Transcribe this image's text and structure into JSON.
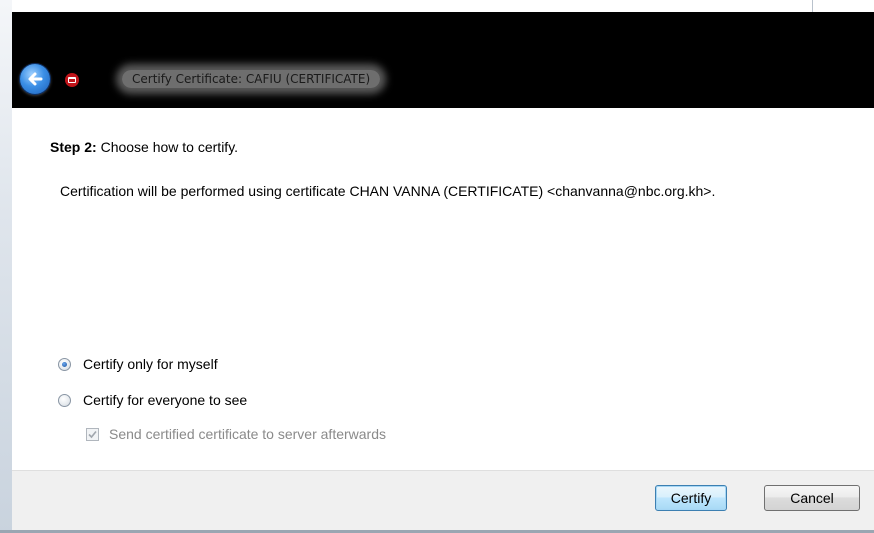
{
  "window": {
    "title": "Certify Certificate: CAFIU (CERTIFICATE)"
  },
  "content": {
    "step_label": "Step 2:",
    "step_text": " Choose how to certify.",
    "description": "Certification will be performed using certificate CHAN VANNA (CERTIFICATE) <chanvanna@nbc.org.kh>."
  },
  "options": {
    "only_myself": {
      "label": "Certify only for myself",
      "checked": true
    },
    "everyone": {
      "label": "Certify for everyone to see",
      "checked": false
    },
    "send_to_server": {
      "label": "Send certified certificate to server afterwards",
      "checked": true,
      "enabled": false
    }
  },
  "footer": {
    "certify_label": "Certify",
    "cancel_label": "Cancel"
  },
  "colors": {
    "titlebar": "#000000",
    "footer": "#f0f0f0",
    "accent": "#3c7fb1"
  },
  "icons": {
    "back": "back-arrow-icon",
    "app": "kleopatra-app-icon"
  }
}
